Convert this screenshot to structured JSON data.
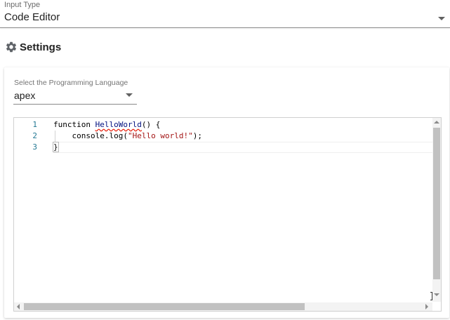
{
  "input_type": {
    "label": "Input Type",
    "value": "Code Editor"
  },
  "settings": {
    "title": "Settings",
    "icon": "gear-icon"
  },
  "language_select": {
    "label": "Select the Programming Language",
    "value": "apex"
  },
  "editor": {
    "line_numbers": [
      "1",
      "2",
      "3"
    ],
    "lines": [
      {
        "kw": "function ",
        "name": "HelloWorld",
        "rest": "() {"
      },
      {
        "indent": "    ",
        "call": "console.log(",
        "str": "\"Hello world!\"",
        "end": ");"
      },
      {
        "brace": "}"
      }
    ]
  },
  "colors": {
    "line_number": "#237893",
    "string": "#a31515",
    "identifier": "#001080",
    "error_squiggle": "#e51400"
  }
}
